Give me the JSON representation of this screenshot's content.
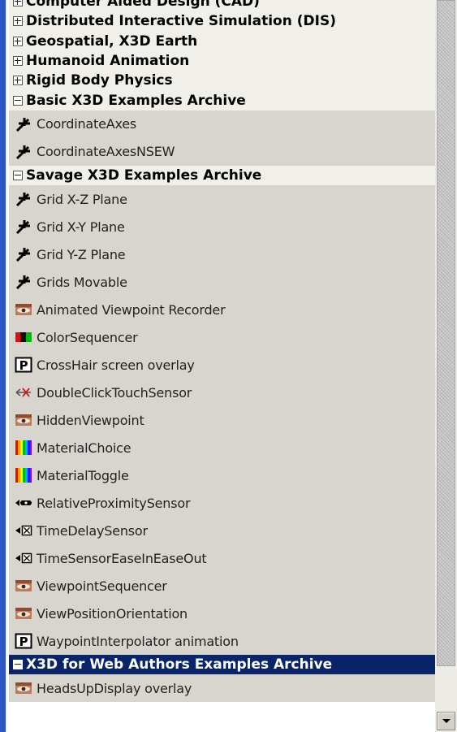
{
  "tree": [
    {
      "type": "category",
      "label": "Computer Aided Design (CAD)",
      "state": "collapsed"
    },
    {
      "type": "category",
      "label": "Distributed Interactive Simulation (DIS)",
      "state": "collapsed"
    },
    {
      "type": "category",
      "label": "Geospatial, X3D Earth",
      "state": "collapsed"
    },
    {
      "type": "category",
      "label": "Humanoid Animation",
      "state": "collapsed"
    },
    {
      "type": "category",
      "label": "Rigid Body Physics",
      "state": "collapsed"
    },
    {
      "type": "category",
      "label": "Basic X3D Examples Archive",
      "state": "expanded"
    },
    {
      "type": "item",
      "label": "CoordinateAxes",
      "icon": "axes-icon"
    },
    {
      "type": "item",
      "label": "CoordinateAxesNSEW",
      "icon": "axes-icon"
    },
    {
      "type": "category",
      "label": "Savage X3D Examples Archive",
      "state": "expanded"
    },
    {
      "type": "item",
      "label": "Grid X-Z Plane",
      "icon": "axes-icon"
    },
    {
      "type": "item",
      "label": "Grid X-Y Plane",
      "icon": "axes-icon"
    },
    {
      "type": "item",
      "label": "Grid Y-Z Plane",
      "icon": "axes-icon"
    },
    {
      "type": "item",
      "label": "Grids Movable",
      "icon": "axes-icon"
    },
    {
      "type": "item",
      "label": "Animated Viewpoint Recorder",
      "icon": "eye-icon"
    },
    {
      "type": "item",
      "label": "ColorSequencer",
      "icon": "color-sequence-icon"
    },
    {
      "type": "item",
      "label": "CrossHair screen overlay",
      "icon": "proto-icon"
    },
    {
      "type": "item",
      "label": "DoubleClickTouchSensor",
      "icon": "touch-sensor-icon"
    },
    {
      "type": "item",
      "label": "HiddenViewpoint",
      "icon": "eye-icon"
    },
    {
      "type": "item",
      "label": "MaterialChoice",
      "icon": "spectrum-icon"
    },
    {
      "type": "item",
      "label": "MaterialToggle",
      "icon": "spectrum-icon"
    },
    {
      "type": "item",
      "label": "RelativeProximitySensor",
      "icon": "proximity-sensor-icon"
    },
    {
      "type": "item",
      "label": "TimeDelaySensor",
      "icon": "time-sensor-icon"
    },
    {
      "type": "item",
      "label": "TimeSensorEaseInEaseOut",
      "icon": "time-sensor-icon"
    },
    {
      "type": "item",
      "label": "ViewpointSequencer",
      "icon": "eye-icon"
    },
    {
      "type": "item",
      "label": "ViewPositionOrientation",
      "icon": "eye-icon"
    },
    {
      "type": "item",
      "label": "WaypointInterpolator animation",
      "icon": "proto-icon"
    },
    {
      "type": "category",
      "label": "X3D for Web Authors Examples Archive",
      "state": "expanded",
      "selected": true
    },
    {
      "type": "item",
      "label": "HeadsUpDisplay overlay",
      "icon": "eye-icon"
    }
  ]
}
